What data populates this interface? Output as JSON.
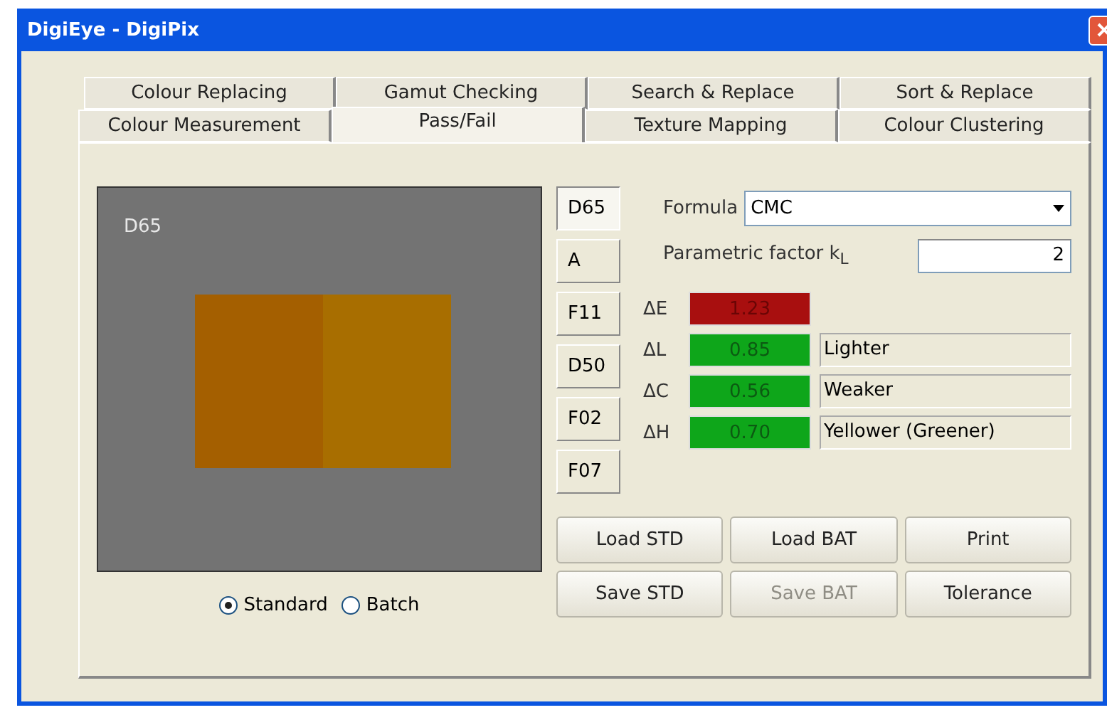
{
  "window": {
    "title": "DigiEye - DigiPix"
  },
  "tab_rows": [
    [
      {
        "label": "Colour Replacing",
        "selected": false
      },
      {
        "label": "Gamut Checking",
        "selected": false
      },
      {
        "label": "Search & Replace",
        "selected": false
      },
      {
        "label": "Sort & Replace",
        "selected": false
      }
    ],
    [
      {
        "label": "Colour Measurement",
        "selected": false
      },
      {
        "label": "Pass/Fail",
        "selected": true
      },
      {
        "label": "Texture Mapping",
        "selected": false
      },
      {
        "label": "Colour Clustering",
        "selected": false
      }
    ]
  ],
  "preview": {
    "label": "D65",
    "swatches": [
      {
        "color": "#a45f00"
      },
      {
        "color": "#a86e00"
      }
    ]
  },
  "view_options": [
    {
      "label": "Standard",
      "selected": true
    },
    {
      "label": "Batch",
      "selected": false
    }
  ],
  "illuminants": [
    {
      "label": "D65",
      "selected": true
    },
    {
      "label": "A",
      "selected": false
    },
    {
      "label": "F11",
      "selected": false
    },
    {
      "label": "D50",
      "selected": false
    },
    {
      "label": "F02",
      "selected": false
    },
    {
      "label": "F07",
      "selected": false
    }
  ],
  "formula": {
    "label": "Formula",
    "value": "CMC"
  },
  "parametric_factor": {
    "label": "Parametric factor k$_{L}$",
    "value": "2"
  },
  "deltas": [
    {
      "symbol": "ΔE",
      "value": "1.23",
      "pass": false
    },
    {
      "symbol": "ΔL",
      "value": "0.85",
      "pass": true,
      "description": "Lighter"
    },
    {
      "symbol": "ΔC",
      "value": "0.56",
      "pass": true,
      "description": "Weaker"
    },
    {
      "symbol": "ΔH",
      "value": "0.70",
      "pass": true,
      "description": "Yellower (Greener)"
    }
  ],
  "buttons": [
    {
      "label": "Load STD",
      "disabled": false
    },
    {
      "label": "Load BAT",
      "disabled": false
    },
    {
      "label": "Print",
      "disabled": false
    },
    {
      "label": "Save STD",
      "disabled": false
    },
    {
      "label": "Save BAT",
      "disabled": true
    },
    {
      "label": "Tolerance",
      "disabled": false
    }
  ]
}
